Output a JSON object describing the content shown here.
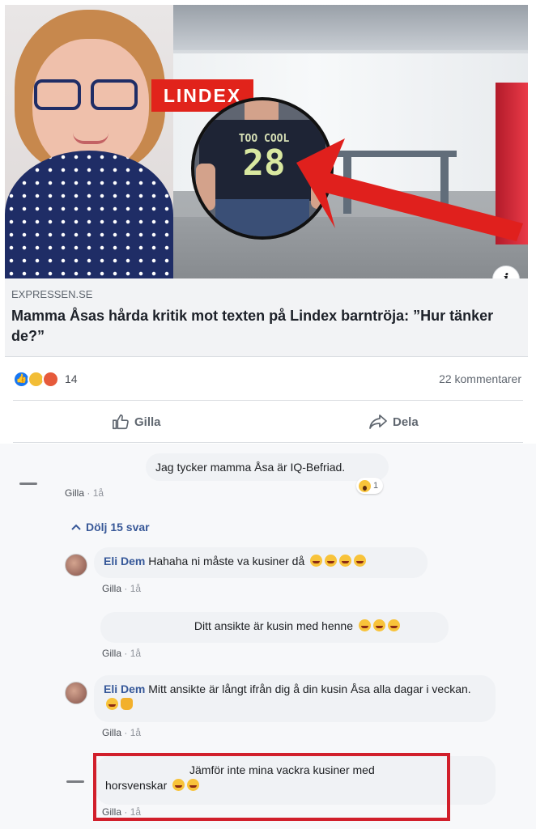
{
  "post": {
    "source": "EXPRESSEN.SE",
    "headline": "Mamma Åsas hårda kritik mot texten på Lindex barntröja: ”Hur tänker de?”",
    "info_icon": "i"
  },
  "image": {
    "store_logo": "LINDEX",
    "shirt_text_small": "TOO COOL",
    "shirt_text_big": "28"
  },
  "stats": {
    "reaction_icons": [
      "like-icon",
      "haha-icon",
      "angry-icon"
    ],
    "reaction_count": "14",
    "comments_count": "22 kommentarer"
  },
  "actions": {
    "like_label": "Gilla",
    "share_label": "Dela"
  },
  "comments": [
    {
      "author": "",
      "text": "Jag tycker mamma Åsa är IQ-Befriad.",
      "like_label": "Gilla",
      "time": "1å",
      "reaction_count": "1"
    }
  ],
  "replies_toggle": "Dölj 15 svar",
  "replies": [
    {
      "author": "Eli Dem",
      "text": "Hahaha ni måste va kusiner då",
      "like_label": "Gilla",
      "time": "1å"
    },
    {
      "author": "",
      "text": "Ditt ansikte är kusin med henne",
      "like_label": "Gilla",
      "time": "1å"
    },
    {
      "author": "Eli Dem",
      "text": "Mitt ansikte är långt ifrån dig å din kusin Åsa alla dagar i veckan.",
      "like_label": "Gilla",
      "time": "1å"
    },
    {
      "author": "",
      "text_line1": "Jämför inte mina vackra kusiner med",
      "text_line2": "horsvenskar",
      "like_label": "Gilla",
      "time": "1å"
    }
  ],
  "colors": {
    "highlight": "#d11f2b",
    "link": "#365899",
    "brand_red": "#e1231b"
  }
}
